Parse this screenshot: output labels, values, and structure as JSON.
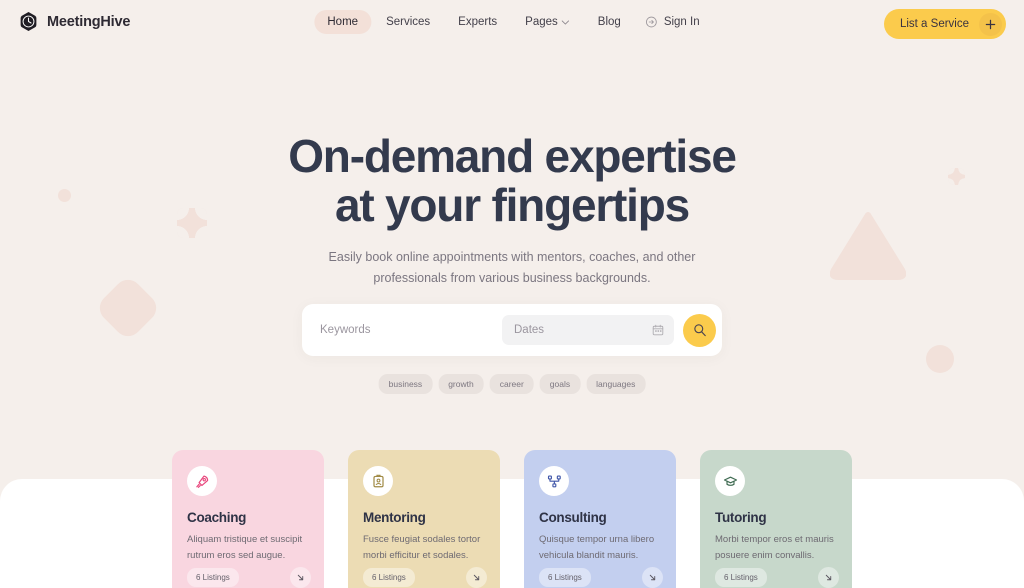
{
  "brand": {
    "name": "MeetingHive",
    "icon": "clock-hexagon-icon"
  },
  "nav": {
    "items": [
      {
        "label": "Home",
        "active": true,
        "dropdown": false
      },
      {
        "label": "Services",
        "active": false,
        "dropdown": false
      },
      {
        "label": "Experts",
        "active": false,
        "dropdown": false
      },
      {
        "label": "Pages",
        "active": false,
        "dropdown": true
      },
      {
        "label": "Blog",
        "active": false,
        "dropdown": false
      }
    ],
    "signin": {
      "label": "Sign In",
      "icon": "sign-in-circle-arrow-icon"
    },
    "cta": {
      "label": "List a Service",
      "icon": "plus-icon",
      "color": "#fbcb4c"
    }
  },
  "hero": {
    "title_line1": "On-demand expertise",
    "title_line2": "at your fingertips",
    "sub_line1": "Easily book online appointments with mentors, coaches, and other",
    "sub_line2": "professionals from various business backgrounds.",
    "title_color": "#333a4d"
  },
  "search": {
    "keywords_placeholder": "Keywords",
    "keywords_value": "",
    "dates_placeholder": "Dates",
    "dates_value": "",
    "calendar_icon": "calendar-icon",
    "submit_icon": "search-icon",
    "submit_color": "#fbcb4c"
  },
  "tags": [
    {
      "label": "business"
    },
    {
      "label": "growth"
    },
    {
      "label": "career"
    },
    {
      "label": "goals"
    },
    {
      "label": "languages"
    }
  ],
  "categories": [
    {
      "title": "Coaching",
      "desc": "Aliquam tristique et suscipit rutrum eros sed augue.",
      "listings": "6 Listings",
      "icon": "rocket-icon",
      "bg": "#f9d6e0",
      "icon_color": "#e8467c"
    },
    {
      "title": "Mentoring",
      "desc": "Fusce feugiat sodales tortor morbi efficitur et sodales.",
      "listings": "6 Listings",
      "icon": "id-badge-icon",
      "bg": "#ecdcb4",
      "icon_color": "#a08a45"
    },
    {
      "title": "Consulting",
      "desc": "Quisque tempor urna libero vehicula blandit mauris.",
      "listings": "6 Listings",
      "icon": "network-nodes-icon",
      "bg": "#c3cfef",
      "icon_color": "#3f55a8"
    },
    {
      "title": "Tutoring",
      "desc": "Morbi tempor eros et mauris posuere enim convallis.",
      "listings": "6 Listings",
      "icon": "graduation-cap-icon",
      "bg": "#c7d8cb",
      "icon_color": "#3f6b52"
    }
  ],
  "theme": {
    "page_bg": "#f5efeb",
    "panel_bg": "#ffffff",
    "deco_color": "#f2e1da"
  }
}
